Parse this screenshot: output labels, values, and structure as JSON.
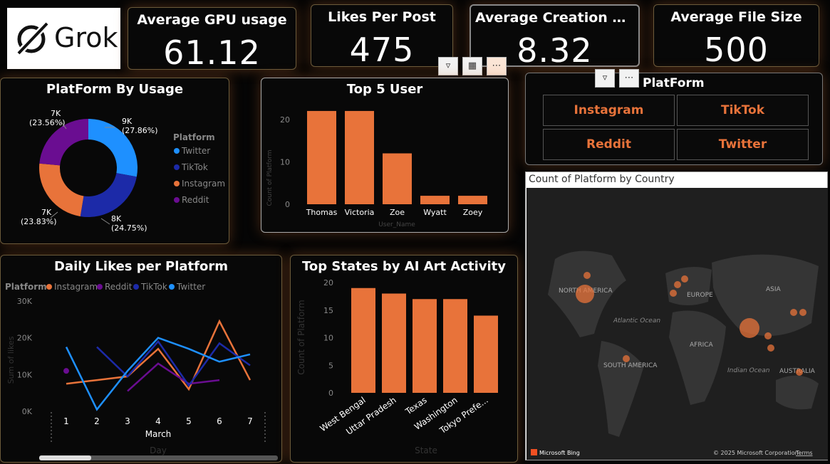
{
  "logo": {
    "text": "Grok"
  },
  "kpis": [
    {
      "title": "Average GPU usage",
      "value": "61.12"
    },
    {
      "title": "Likes Per Post",
      "value": "475"
    },
    {
      "title": "Average Creation Ti...",
      "value": "8.32"
    },
    {
      "title": "Average File Size",
      "value": "500"
    }
  ],
  "platform_usage": {
    "title": "PlatForm By Usage",
    "legend_title": "Platform",
    "legend": [
      "Twitter",
      "TikTok",
      "Instagram",
      "Reddit"
    ],
    "labels": [
      {
        "value": "9K",
        "pct": "(27.86%)"
      },
      {
        "value": "8K",
        "pct": "(24.75%)"
      },
      {
        "value": "7K",
        "pct": "(23.83%)"
      },
      {
        "value": "7K",
        "pct": "(23.56%)"
      }
    ]
  },
  "top_users": {
    "title": "Top 5 User",
    "xlabel": "User_Name",
    "ylabel": "Count of Platform"
  },
  "slicer": {
    "title": "PlatForm",
    "options": [
      "Instagram",
      "TikTok",
      "Reddit",
      "Twitter"
    ]
  },
  "daily_likes": {
    "title": "Daily Likes per Platform",
    "legend_title": "Platform",
    "legend": [
      "Instagram",
      "Reddit",
      "TikTok",
      "Twitter"
    ],
    "xlabel": "Day",
    "month_label": "March",
    "ylabel": "Sum of likes"
  },
  "top_states": {
    "title": "Top States by AI Art Activity",
    "xlabel": "State",
    "ylabel": "Count of Platform"
  },
  "map": {
    "title": "Count of Platform by Country",
    "labels": [
      "NORTH AMERICA",
      "EUROPE",
      "ASIA",
      "Atlantic Ocean",
      "AFRICA",
      "SOUTH AMERICA",
      "Indian Ocean",
      "AUSTRALIA"
    ],
    "bing": "Microsoft Bing",
    "copyright": "© 2025 Microsoft Corporation",
    "terms": "Terms"
  },
  "colors": {
    "accent": "#e8733a",
    "twitter": "#1e90ff",
    "tiktok": "#1c2aa8",
    "instagram": "#e8733a",
    "reddit": "#6a0d91"
  },
  "chart_data": [
    {
      "type": "pie",
      "title": "PlatForm By Usage",
      "categories": [
        "Twitter",
        "TikTok",
        "Instagram",
        "Reddit"
      ],
      "values": [
        27.86,
        24.75,
        23.83,
        23.56
      ]
    },
    {
      "type": "bar",
      "title": "Top 5 User",
      "categories": [
        "Thomas",
        "Victoria",
        "Zoe",
        "Wyatt",
        "Zoey"
      ],
      "values": [
        22,
        22,
        12,
        2,
        2
      ],
      "xlabel": "User_Name",
      "ylabel": "Count of Platform",
      "yticks": [
        0,
        10,
        20
      ],
      "ylim": [
        0,
        24
      ]
    },
    {
      "type": "line",
      "title": "Daily Likes per Platform",
      "x": [
        1,
        2,
        3,
        4,
        5,
        6,
        7
      ],
      "xlabel": "Day",
      "ylabel": "Sum of likes",
      "yticks": [
        "0K",
        "10K",
        "20K",
        "30K"
      ],
      "ylim": [
        0,
        30000
      ],
      "series": [
        {
          "name": "Instagram",
          "values": [
            7500,
            8500,
            9500,
            17000,
            6000,
            24500,
            8500
          ]
        },
        {
          "name": "Reddit",
          "values": [
            11000,
            null,
            5500,
            13000,
            7500,
            8500,
            null
          ]
        },
        {
          "name": "TikTok",
          "values": [
            null,
            17500,
            9500,
            19000,
            7000,
            18500,
            12500
          ]
        },
        {
          "name": "Twitter",
          "values": [
            17500,
            500,
            11000,
            20000,
            17000,
            13500,
            15500
          ]
        }
      ]
    },
    {
      "type": "bar",
      "title": "Top States by AI Art Activity",
      "categories": [
        "West Bengal",
        "Uttar Pradesh",
        "Texas",
        "Washington",
        "Tokyo Prefe..."
      ],
      "values": [
        19,
        18,
        17,
        17,
        14
      ],
      "xlabel": "State",
      "ylabel": "Count of Platform",
      "yticks": [
        0,
        5,
        10,
        15,
        20
      ],
      "ylim": [
        0,
        20
      ]
    }
  ]
}
